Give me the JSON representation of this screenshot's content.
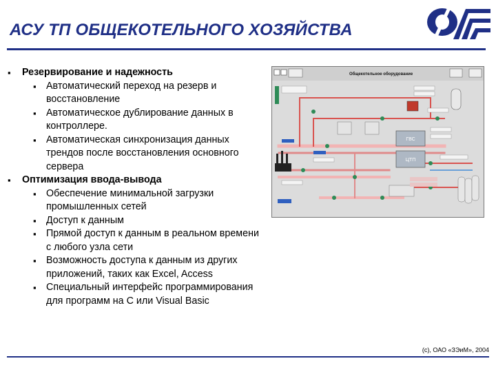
{
  "slide": {
    "title": "АСУ ТП ОБЩЕКОТЕЛЬНОГО ХОЗЯЙСТВА",
    "copyright": "(c), ОАО «ЗЭиМ», 2004"
  },
  "bullets": [
    {
      "level": 1,
      "text": "Резервирование и надежность"
    },
    {
      "level": 2,
      "text": "Автоматический переход на резерв и восстановление"
    },
    {
      "level": 2,
      "text": "Автоматическое дублирование данных в контроллере."
    },
    {
      "level": 2,
      "text": "Автоматическая синхронизация данных трендов после восстановления основного сервера"
    },
    {
      "level": 1,
      "text": "Оптимизация ввода-вывода"
    },
    {
      "level": 2,
      "text": "Обеспечение минимальной загрузки промышленных сетей"
    },
    {
      "level": 2,
      "text": "Доступ к данным"
    },
    {
      "level": 2,
      "text": "Прямой доступ к данным в реальном времени с любого узла сети"
    },
    {
      "level": 2,
      "text": "Возможность доступа к данным из других приложений, таких как Excel, Access"
    },
    {
      "level": 2,
      "text": "Специальный интерфейс программирования для программ на С или Visual Basic"
    }
  ],
  "scada": {
    "window_title": "Общекотельное оборудование",
    "units": [
      "ГВС",
      "ЦТП"
    ],
    "colors": {
      "hot_pipe": "#d9534f",
      "cold_pipe": "#e08a8a",
      "pipe_pink": "#f2b4b4",
      "valve": "#2e8b57",
      "panel": "#dcdcdc"
    }
  }
}
